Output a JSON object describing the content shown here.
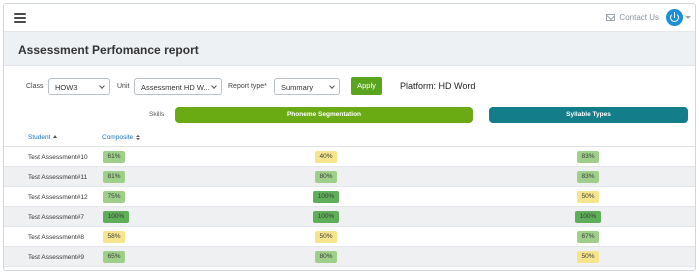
{
  "header": {
    "contact_label": "Contact Us"
  },
  "page": {
    "title": "Assessment Perfomance report"
  },
  "filters": {
    "class_label": "Class",
    "class_value": "HOW3",
    "unit_label": "Unit",
    "unit_value": "Assessment HD W...",
    "report_type_label": "Report type*",
    "report_type_value": "Summary",
    "apply_label": "Apply",
    "platform_text": "Platform: HD Word"
  },
  "skills": {
    "label": "Skills",
    "items": [
      {
        "label": "Phoneme Segmentation",
        "color": "#6aab14"
      },
      {
        "label": "Syllable Types",
        "color": "#137d8a"
      }
    ]
  },
  "table": {
    "headers": {
      "student": "Student",
      "composite": "Composite"
    },
    "rows": [
      {
        "student": "Test Assessment#10",
        "composite": "61%",
        "phoneme": "40%",
        "syllable": "83%"
      },
      {
        "student": "Test Assessment#11",
        "composite": "81%",
        "phoneme": "80%",
        "syllable": "83%"
      },
      {
        "student": "Test Assessment#12",
        "composite": "75%",
        "phoneme": "100%",
        "syllable": "50%"
      },
      {
        "student": "Test Assessment#7",
        "composite": "100%",
        "phoneme": "100%",
        "syllable": "100%"
      },
      {
        "student": "Test Assessment#8",
        "composite": "58%",
        "phoneme": "50%",
        "syllable": "67%"
      },
      {
        "student": "Test Assessment#9",
        "composite": "65%",
        "phoneme": "80%",
        "syllable": "50%"
      }
    ]
  },
  "colors": {
    "high": "#5fae5a",
    "mid": "#9fd08a",
    "low": "#f6e58c"
  }
}
